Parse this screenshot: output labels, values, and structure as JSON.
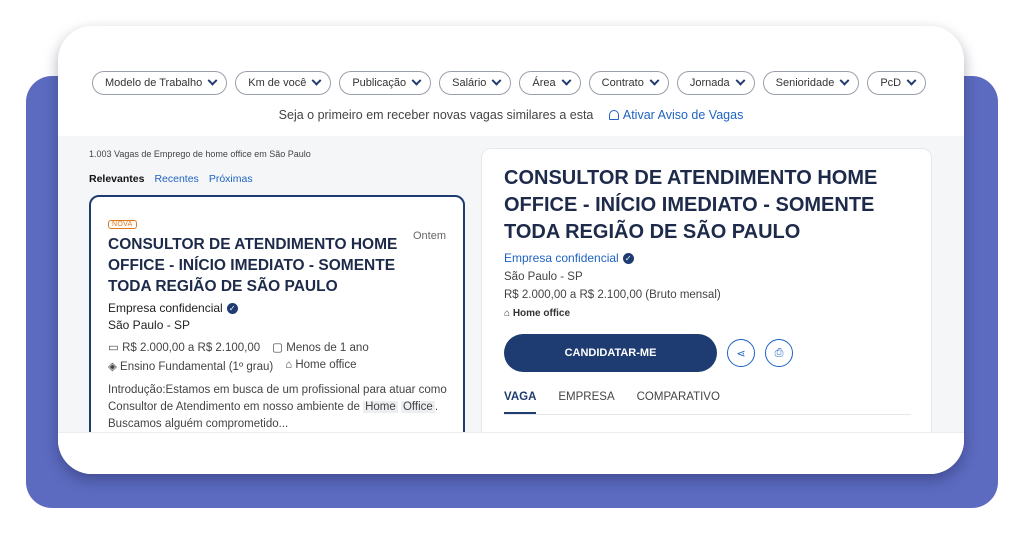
{
  "filters": [
    "Modelo de Trabalho",
    "Km de você",
    "Publicação",
    "Salário",
    "Área",
    "Contrato",
    "Jornada",
    "Senioridade",
    "PcD"
  ],
  "alert": {
    "text": "Seja o primeiro em receber novas vagas similares a esta",
    "link": "Ativar Aviso de Vagas"
  },
  "results": {
    "count": "1.003 Vagas de Emprego de home office em São Paulo"
  },
  "sort": {
    "active": "Relevantes",
    "options": [
      "Recentes",
      "Próximas"
    ]
  },
  "job": {
    "badge": "NOVA",
    "date": "Ontem",
    "title": "CONSULTOR DE ATENDIMENTO HOME OFFICE - INÍCIO IMEDIATO - SOMENTE TODA REGIÃO DE SÃO PAULO",
    "company": "Empresa confidencial",
    "location": "São Paulo - SP",
    "salary": "R$ 2.000,00 a R$ 2.100,00",
    "experience": "Menos de 1 ano",
    "education": "Ensino Fundamental (1º grau)",
    "mode": "Home office",
    "desc_part1": "Introdução:Estamos em busca de um profissional para atuar como Consultor de Atendimento em nosso ambiente de",
    "desc_highlight1": "Home",
    "desc_highlight2": "Office",
    "desc_part2": ". Buscamos alguém comprometido..."
  },
  "detail": {
    "title": "CONSULTOR DE ATENDIMENTO HOME OFFICE - INÍCIO IMEDIATO - SOMENTE TODA REGIÃO DE SÃO PAULO",
    "company": "Empresa confidencial",
    "location": "São Paulo - SP",
    "salary": "R$ 2.000,00 a R$ 2.100,00 (Bruto mensal)",
    "mode": "Home office",
    "apply": "CANDIDATAR-ME",
    "tabs": [
      "VAGA",
      "EMPRESA",
      "COMPARATIVO"
    ]
  }
}
